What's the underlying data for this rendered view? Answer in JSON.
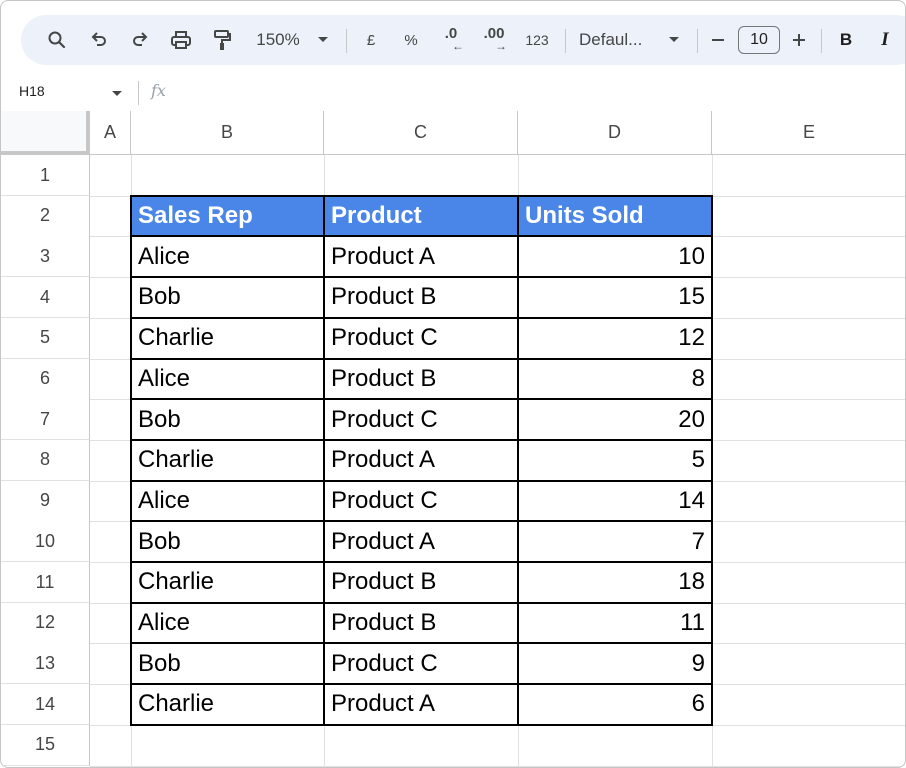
{
  "toolbar": {
    "zoom": "150%",
    "currency": "£",
    "percent": "%",
    "decrease_decimal": ".0",
    "increase_decimal": ".00",
    "format_number": "123",
    "font": "Defaul...",
    "font_size": "10",
    "bold": "B",
    "italic": "I"
  },
  "formula_bar": {
    "cell_ref": "H18",
    "fx": "fx"
  },
  "columns": [
    "A",
    "B",
    "C",
    "D",
    "E"
  ],
  "rows": [
    "1",
    "2",
    "3",
    "4",
    "5",
    "6",
    "7",
    "8",
    "9",
    "10",
    "11",
    "12",
    "13",
    "14",
    "15"
  ],
  "table": {
    "headers": [
      "Sales Rep",
      "Product",
      "Units Sold"
    ],
    "rows": [
      [
        "Alice",
        "Product A",
        "10"
      ],
      [
        "Bob",
        "Product B",
        "15"
      ],
      [
        "Charlie",
        "Product C",
        "12"
      ],
      [
        "Alice",
        "Product B",
        "8"
      ],
      [
        "Bob",
        "Product C",
        "20"
      ],
      [
        "Charlie",
        "Product A",
        "5"
      ],
      [
        "Alice",
        "Product C",
        "14"
      ],
      [
        "Bob",
        "Product A",
        "7"
      ],
      [
        "Charlie",
        "Product B",
        "18"
      ],
      [
        "Alice",
        "Product B",
        "11"
      ],
      [
        "Bob",
        "Product C",
        "9"
      ],
      [
        "Charlie",
        "Product A",
        "6"
      ]
    ]
  },
  "colors": {
    "header_fill": "#4a86e8",
    "toolbar_bg": "#edf2fa"
  }
}
